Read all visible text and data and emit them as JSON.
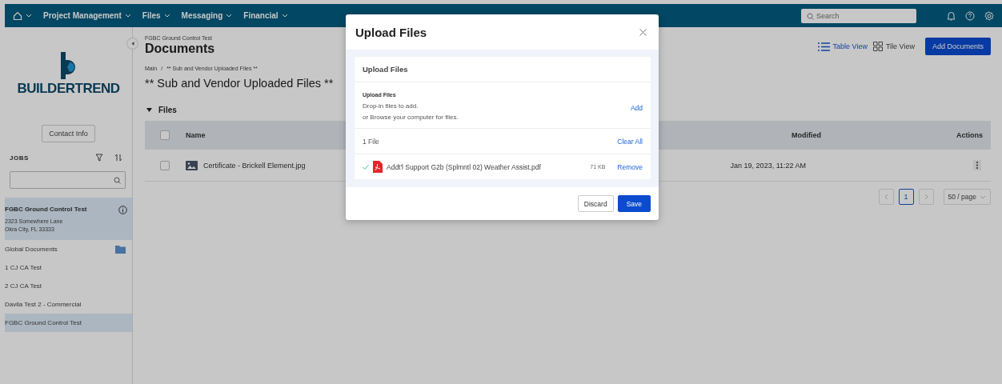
{
  "topnav": {
    "items": [
      {
        "kind": "home"
      },
      {
        "kind": "menu",
        "label": "Project Management"
      },
      {
        "kind": "menu",
        "label": "Files"
      },
      {
        "kind": "menu",
        "label": "Messaging"
      },
      {
        "kind": "menu",
        "label": "Financial"
      }
    ],
    "search": {
      "placeholder": "Search"
    }
  },
  "sidebar": {
    "logo": "BUILDERTREND",
    "contact_button": "Contact Info",
    "jobs_label": "JOBS",
    "current_job": {
      "name": "FGBC Ground Control Test",
      "address": [
        "2323 Somewhere Lane",
        "Okra City, FL 33333"
      ]
    },
    "jobs": [
      {
        "name": "Global Documents",
        "kind": "folder",
        "selected": false
      },
      {
        "name": "1 CJ CA Test",
        "kind": "job",
        "selected": false
      },
      {
        "name": "2 CJ CA Test",
        "kind": "job",
        "selected": false
      },
      {
        "name": "Davila Test 2 - Commercial",
        "kind": "job",
        "selected": false
      },
      {
        "name": "FGBC Ground Control Test",
        "kind": "job",
        "selected": true
      }
    ]
  },
  "main": {
    "job_name": "FGBC Ground Control Test",
    "title": "Documents",
    "breadcrumb": {
      "items": [
        "Main",
        "** Sub and Vendor Uploaded Files **"
      ],
      "separator": "/"
    },
    "folder_title": "** Sub and Vendor Uploaded Files **",
    "views": [
      {
        "kind": "table",
        "label": "Table View",
        "selected": true
      },
      {
        "kind": "tile",
        "label": "Tile View",
        "selected": false
      }
    ],
    "add_button": "Add Documents",
    "section": {
      "label": "Files",
      "expanded": true
    },
    "table": {
      "select_all_checked": false,
      "columns": [
        "Name",
        "Modified",
        "Actions"
      ],
      "rows": [
        {
          "name": "Certificate - Brickell Element.jpg",
          "modified": "Jan 19, 2023, 11:22 AM",
          "checked": false
        }
      ]
    },
    "pagination": {
      "pages": [
        {
          "label": "1",
          "selected": true
        }
      ],
      "page_size": "50 / page"
    }
  },
  "modal": {
    "title": "Upload Files",
    "card_title": "Upload Files",
    "drop_label": "Upload Files",
    "drop_hint": [
      "Drop-in files to add.",
      "or Browse your computer for files."
    ],
    "add_link": "Add",
    "count": "1 File",
    "clear_all": "Clear All",
    "files": [
      {
        "name": "Addt'l Support G2b (Splmntl 02) Weather Assist.pdf",
        "size": "71 KB",
        "remove": "Remove",
        "uploaded": true
      }
    ],
    "discard": "Discard",
    "save": "Save"
  }
}
